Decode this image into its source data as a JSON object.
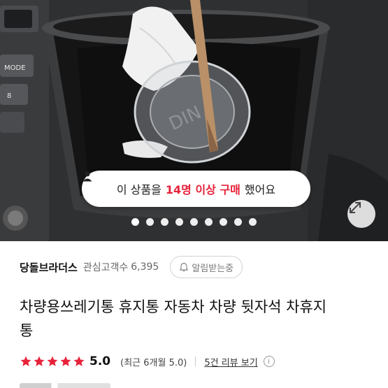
{
  "hero": {
    "dashboard_mode_label": "MODE",
    "dashboard_number_label": "8",
    "buyers_banner": {
      "prefix": "이 상품을",
      "highlight": "14명 이상 구매",
      "suffix": "했어요"
    },
    "carousel": {
      "total": 9,
      "active_index": 0
    },
    "colors": {
      "highlight": "#e7223a"
    }
  },
  "seller": {
    "name": "당돌브라더스",
    "followers_label": "관심고객수",
    "followers_count": "6,395",
    "alert_button_label": "알림받는중"
  },
  "product": {
    "title_line1": "차량용쓰레기통 휴지통 자동차 차량 뒷자석 차휴지",
    "title_line2": "통"
  },
  "rating": {
    "stars": 5,
    "star_color": "#e7223a",
    "value": "5.0",
    "recent_label": "(최근 6개월 5.0)",
    "reviews_link": "5건 리뷰 보기",
    "info_icon": "i"
  }
}
